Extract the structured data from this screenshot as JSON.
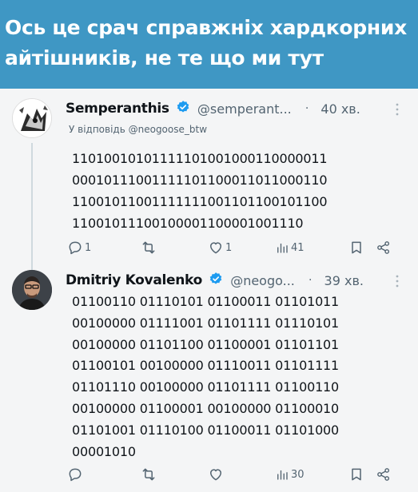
{
  "banner": {
    "line1": "Ось це срач справжніх хардкорних",
    "line2": "айтішників, не те що ми тут"
  },
  "tweets": [
    {
      "name": "Semperanthis",
      "handle": "@semperant...",
      "dot": "·",
      "time": "40 хв.",
      "reply_to": "У відповідь @neogoose_btw",
      "body": "11010010101111101001000110000011\n00010111001111101100011011000110\n11001011001111111001101100101100\n11001011100100001100001001110",
      "actions": {
        "replies": "1",
        "reposts": "",
        "likes": "1",
        "views": "41"
      }
    },
    {
      "name": "Dmitriy Kovalenko",
      "handle": "@neogo...",
      "dot": "·",
      "time": "39 хв.",
      "body": "01100110 01110101 01100011 01101011\n00100000 01111001 01101111 01110101\n00100000 01101100 01100001 01101101\n01100101 00100000 01110011 01101111\n01101110 00100000 01101111 01100110\n00100000 01100001 00100000 01100010\n01101001 01110100 01100011 01101000\n00001010",
      "actions": {
        "replies": "",
        "reposts": "",
        "likes": "",
        "views": "30"
      }
    }
  ],
  "colors": {
    "banner_bg": "#3f97c4",
    "card_bg": "#f4f5f6",
    "verified_blue": "#1d9bf0",
    "secondary_text": "#536471"
  },
  "icons": {
    "reply": "reply-icon",
    "repost": "repost-icon",
    "like": "heart-icon",
    "views": "views-icon",
    "bookmark": "bookmark-icon",
    "share": "share-icon",
    "more": "more-icon",
    "verified": "verified-badge-icon"
  }
}
